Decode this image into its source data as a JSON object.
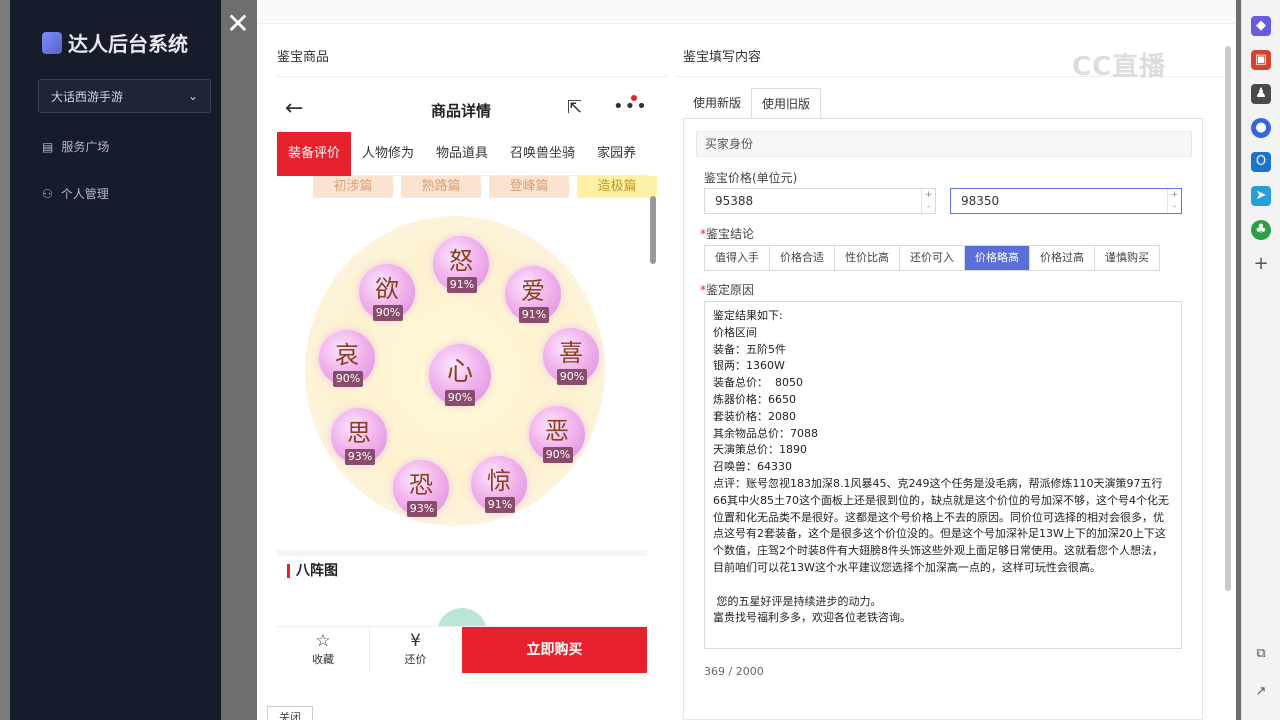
{
  "sidebar": {
    "brand": "达人后台系统",
    "game_select": "大话西游手游",
    "items": [
      {
        "label": "服务广场",
        "icon": "building-icon"
      },
      {
        "label": "个人管理",
        "icon": "user-icon"
      }
    ]
  },
  "drawer": {
    "left_title": "鉴宝商品",
    "right_title": "鉴宝填写内容",
    "close_button": "关闭"
  },
  "phone": {
    "title": "商品详情",
    "tabs": [
      "装备评价",
      "人物修为",
      "物品道具",
      "召唤兽坐骑",
      "家园养"
    ],
    "active_tab": "装备评价",
    "levels": [
      "初涉篇",
      "熟路篇",
      "登峰篇",
      "造极篇"
    ],
    "active_level": "造极篇",
    "wheel": [
      {
        "char": "怒",
        "pct": "91%"
      },
      {
        "char": "爱",
        "pct": "91%"
      },
      {
        "char": "喜",
        "pct": "90%"
      },
      {
        "char": "恶",
        "pct": "90%"
      },
      {
        "char": "惊",
        "pct": "91%"
      },
      {
        "char": "恐",
        "pct": "93%"
      },
      {
        "char": "思",
        "pct": "93%"
      },
      {
        "char": "哀",
        "pct": "90%"
      },
      {
        "char": "欲",
        "pct": "90%"
      },
      {
        "char": "心",
        "pct": "90%"
      }
    ],
    "section_title": "八阵图",
    "bottom": {
      "favorite": "收藏",
      "bargain": "还价",
      "buy": "立即购买"
    }
  },
  "form": {
    "tabs": [
      "使用新版",
      "使用旧版"
    ],
    "active_tab": "使用旧版",
    "buyer_section": "买家身份",
    "price_label": "鉴宝价格(单位元)",
    "price_low": "95388",
    "price_high": "98350",
    "conclusion_label": "鉴宝结论",
    "conclusions": [
      "值得入手",
      "价格合适",
      "性价比高",
      "还价可入",
      "价格略高",
      "价格过高",
      "谨慎购买"
    ],
    "active_conclusion": "价格略高",
    "reason_label": "鉴定原因",
    "reason_text": "鉴定结果如下:\n价格区间\n装备：五阶5件\n银两：1360W\n装备总价：  8050\n炼器价格：6650\n套装价格：2080\n其余物品总价：7088\n天演策总价：1890\n召唤兽：64330\n点评：账号忽视183加深8.1风暴45、克249这个任务是没毛病，帮派修炼110天演策97五行66其中火85土70这个面板上还是很到位的，缺点就是这个价位的号加深不够，这个号4个化无位置和化无品类不是很好。这都是这个号价格上不去的原因。同价位可选择的相对会很多，优点这号有2套装备，这个是很多这个价位没的。但是这个号加深补足13W上下的加深20上下这个数值，庄驾2个时装8件有大翅膀8件头饰这些外观上面足够日常使用。这就看您个人想法，目前咱们可以花13W这个水平建议您选择个加深高一点的，这样可玩性会很高。\n\n 您的五星好评是持续进步的动力。\n富贵找号福利多多，欢迎各位老铁咨询。",
    "counter": "369 / 2000"
  },
  "watermark": "CC直播",
  "colors": {
    "accent_red": "#e8222d",
    "accent_blue": "#5b6fd8",
    "sidebar_bg": "#171c2b"
  }
}
